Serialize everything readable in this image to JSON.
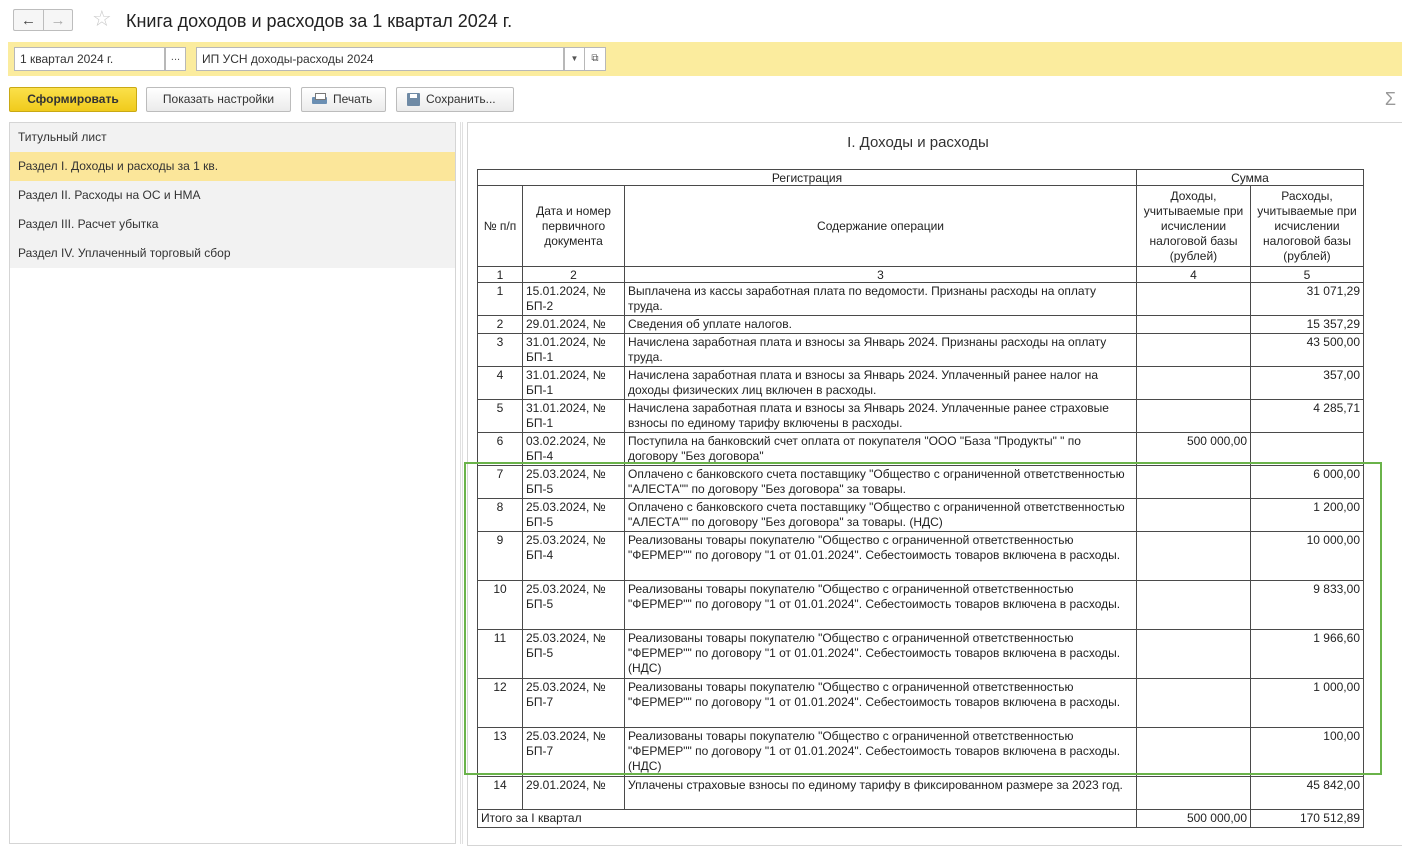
{
  "window": {
    "title": "Книга доходов и расходов за 1 квартал 2024 г."
  },
  "filters": {
    "period": "1 квартал 2024 г.",
    "period_btn": "...",
    "organization": "ИП УСН доходы-расходы 2024"
  },
  "toolbar": {
    "generate_label": "Сформировать",
    "settings_label": "Показать настройки",
    "print_label": "Печать",
    "save_label": "Сохранить..."
  },
  "sidebar": {
    "items": [
      {
        "label": "Титульный лист",
        "active": false
      },
      {
        "label": "Раздел I. Доходы и расходы за 1 кв.",
        "active": true
      },
      {
        "label": "Раздел II. Расходы на ОС и НМА",
        "active": false
      },
      {
        "label": "Раздел III. Расчет убытка",
        "active": false
      },
      {
        "label": "Раздел IV. Уплаченный торговый сбор",
        "active": false
      }
    ]
  },
  "report": {
    "title": "I. Доходы и расходы",
    "headers": {
      "registration": "Регистрация",
      "sum": "Сумма",
      "no": "№ п/п",
      "date_doc": "Дата и номер первичного документа",
      "content": "Содержание операции",
      "income": "Доходы, учитываемые при исчислении налоговой базы (рублей)",
      "expense": "Расходы, учитываемые при исчислении налоговой базы (рублей)",
      "col1": "1",
      "col2": "2",
      "col3": "3",
      "col4": "4",
      "col5": "5"
    },
    "rows": [
      {
        "no": "1",
        "doc": "15.01.2024, № БП-2",
        "content": "Выплачена из кассы заработная плата по ведомости. Признаны расходы на оплату труда.",
        "income": "",
        "expense": "31 071,29"
      },
      {
        "no": "2",
        "doc": "29.01.2024, №",
        "content": "Сведения об уплате налогов.",
        "income": "",
        "expense": "15 357,29"
      },
      {
        "no": "3",
        "doc": "31.01.2024, № БП-1",
        "content": "Начислена заработная плата и взносы за Январь 2024. Признаны расходы на оплату труда.",
        "income": "",
        "expense": "43 500,00"
      },
      {
        "no": "4",
        "doc": "31.01.2024, № БП-1",
        "content": "Начислена заработная плата и взносы за Январь 2024. Уплаченный ранее налог на доходы физических лиц включен в расходы.",
        "income": "",
        "expense": "357,00"
      },
      {
        "no": "5",
        "doc": "31.01.2024, № БП-1",
        "content": "Начислена заработная плата и взносы за Январь 2024. Уплаченные ранее страховые взносы по единому тарифу включены в расходы.",
        "income": "",
        "expense": "4 285,71"
      },
      {
        "no": "6",
        "doc": "03.02.2024, № БП-4",
        "content": "Поступила на банковский счет оплата от покупателя \"ООО \"База \"Продукты\" \" по договору \"Без договора\"",
        "income": "500 000,00",
        "expense": ""
      },
      {
        "no": "7",
        "doc": "25.03.2024, № БП-5",
        "content": "Оплачено с банковского счета поставщику \"Общество с ограниченной ответственностью \"АЛЕСТА\"\" по договору \"Без договора\" за товары.",
        "income": "",
        "expense": "6 000,00"
      },
      {
        "no": "8",
        "doc": "25.03.2024, № БП-5",
        "content": "Оплачено с банковского счета поставщику \"Общество с ограниченной ответственностью \"АЛЕСТА\"\" по договору \"Без договора\" за товары. (НДС)",
        "income": "",
        "expense": "1 200,00"
      },
      {
        "no": "9",
        "doc": "25.03.2024, № БП-4",
        "content": "Реализованы товары покупателю \"Общество с ограниченной ответственностью \"ФЕРМЕР\"\" по договору \"1 от 01.01.2024\". Себестоимость товаров включена в расходы.",
        "income": "",
        "expense": "10 000,00"
      },
      {
        "no": "10",
        "doc": "25.03.2024, № БП-5",
        "content": "Реализованы товары покупателю \"Общество с ограниченной ответственностью \"ФЕРМЕР\"\" по договору \"1 от 01.01.2024\". Себестоимость товаров включена в расходы.",
        "income": "",
        "expense": "9 833,00"
      },
      {
        "no": "11",
        "doc": "25.03.2024, № БП-5",
        "content": "Реализованы товары покупателю \"Общество с ограниченной ответственностью \"ФЕРМЕР\"\" по договору \"1 от 01.01.2024\". Себестоимость товаров включена в расходы. (НДС)",
        "income": "",
        "expense": "1 966,60"
      },
      {
        "no": "12",
        "doc": "25.03.2024, № БП-7",
        "content": "Реализованы товары покупателю \"Общество с ограниченной ответственностью \"ФЕРМЕР\"\" по договору \"1 от 01.01.2024\". Себестоимость товаров включена в расходы.",
        "income": "",
        "expense": "1 000,00"
      },
      {
        "no": "13",
        "doc": "25.03.2024, № БП-7",
        "content": "Реализованы товары покупателю \"Общество с ограниченной ответственностью \"ФЕРМЕР\"\" по договору \"1 от 01.01.2024\". Себестоимость товаров включена в расходы. (НДС)",
        "income": "",
        "expense": "100,00"
      },
      {
        "no": "14",
        "doc": "29.01.2024, №",
        "content": "Уплачены страховые взносы по единому тарифу в фиксированном размере за 2023 год.",
        "income": "",
        "expense": "45 842,00"
      }
    ],
    "total": {
      "label": "Итого за I квартал",
      "income": "500 000,00",
      "expense": "170 512,89"
    }
  },
  "colors": {
    "accent_yellow": "#fbec9e",
    "selected_item": "#fbe69a",
    "primary_button": "#f0cb1c",
    "highlight_frame": "#6ab34a"
  }
}
